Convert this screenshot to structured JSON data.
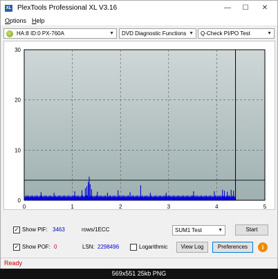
{
  "window": {
    "title": "PlexTools Professional XL V3.16",
    "app_icon": "XL",
    "min_glyph": "—",
    "max_glyph": "☐",
    "close_glyph": "✕"
  },
  "menu": {
    "options": "Options",
    "help": "Help"
  },
  "toolbar": {
    "drive": "HA:8 ID:0  PX-760A",
    "function": "DVD Diagnostic Functions",
    "test": "Q-Check PI/PO Test",
    "arrow": "▼"
  },
  "chart_data": {
    "type": "bar",
    "title": "",
    "xlabel": "",
    "ylabel": "",
    "xlim": [
      0,
      5
    ],
    "ylim": [
      0,
      30
    ],
    "x_ticks": [
      0,
      1,
      2,
      3,
      4,
      5
    ],
    "y_ticks": [
      0,
      10,
      20,
      30
    ],
    "grid": true,
    "threshold": 4,
    "end_marker_x": 4.39,
    "baseline_value": 1,
    "spikes": [
      {
        "x": 0.35,
        "y": 1.6
      },
      {
        "x": 0.62,
        "y": 1.5
      },
      {
        "x": 1.05,
        "y": 1.8
      },
      {
        "x": 1.2,
        "y": 2.0
      },
      {
        "x": 1.27,
        "y": 2.4
      },
      {
        "x": 1.3,
        "y": 2.8
      },
      {
        "x": 1.33,
        "y": 3.6
      },
      {
        "x": 1.35,
        "y": 4.7
      },
      {
        "x": 1.37,
        "y": 3.2
      },
      {
        "x": 1.4,
        "y": 2.2
      },
      {
        "x": 1.52,
        "y": 1.7
      },
      {
        "x": 1.73,
        "y": 1.5
      },
      {
        "x": 1.95,
        "y": 2.0
      },
      {
        "x": 2.2,
        "y": 1.6
      },
      {
        "x": 2.42,
        "y": 3.0
      },
      {
        "x": 2.62,
        "y": 1.5
      },
      {
        "x": 2.95,
        "y": 1.5
      },
      {
        "x": 3.52,
        "y": 1.8
      },
      {
        "x": 3.95,
        "y": 1.8
      },
      {
        "x": 4.12,
        "y": 2.1
      },
      {
        "x": 4.16,
        "y": 1.9
      },
      {
        "x": 4.22,
        "y": 1.7
      },
      {
        "x": 4.3,
        "y": 2.1
      },
      {
        "x": 4.35,
        "y": 1.9
      }
    ],
    "colors": {
      "plot_top": "#cfd7d7",
      "plot_bottom": "#9eb0b0",
      "bars": "#0000e0",
      "grid": "#555555",
      "threshold": "#000000"
    }
  },
  "controls": {
    "show_pif_label": "Show PIF:",
    "show_pif_checked": "✓",
    "pif_value": "3463",
    "rows_label": "rows/1ECC",
    "show_pof_label": "Show POF:",
    "show_pof_checked": "✓",
    "pof_value": "0",
    "lsn_label": "LSN:",
    "lsn_value": "2298496",
    "logarithmic_label": "Logarithmic",
    "logarithmic_checked": "",
    "sum_select": "SUM1 Test",
    "start_button": "Start",
    "viewlog_button": "View Log",
    "preferences_button": "Preferences",
    "info_button": "i"
  },
  "status": {
    "text": "Ready"
  },
  "caption": {
    "text": "569x551  25kb  PNG"
  }
}
